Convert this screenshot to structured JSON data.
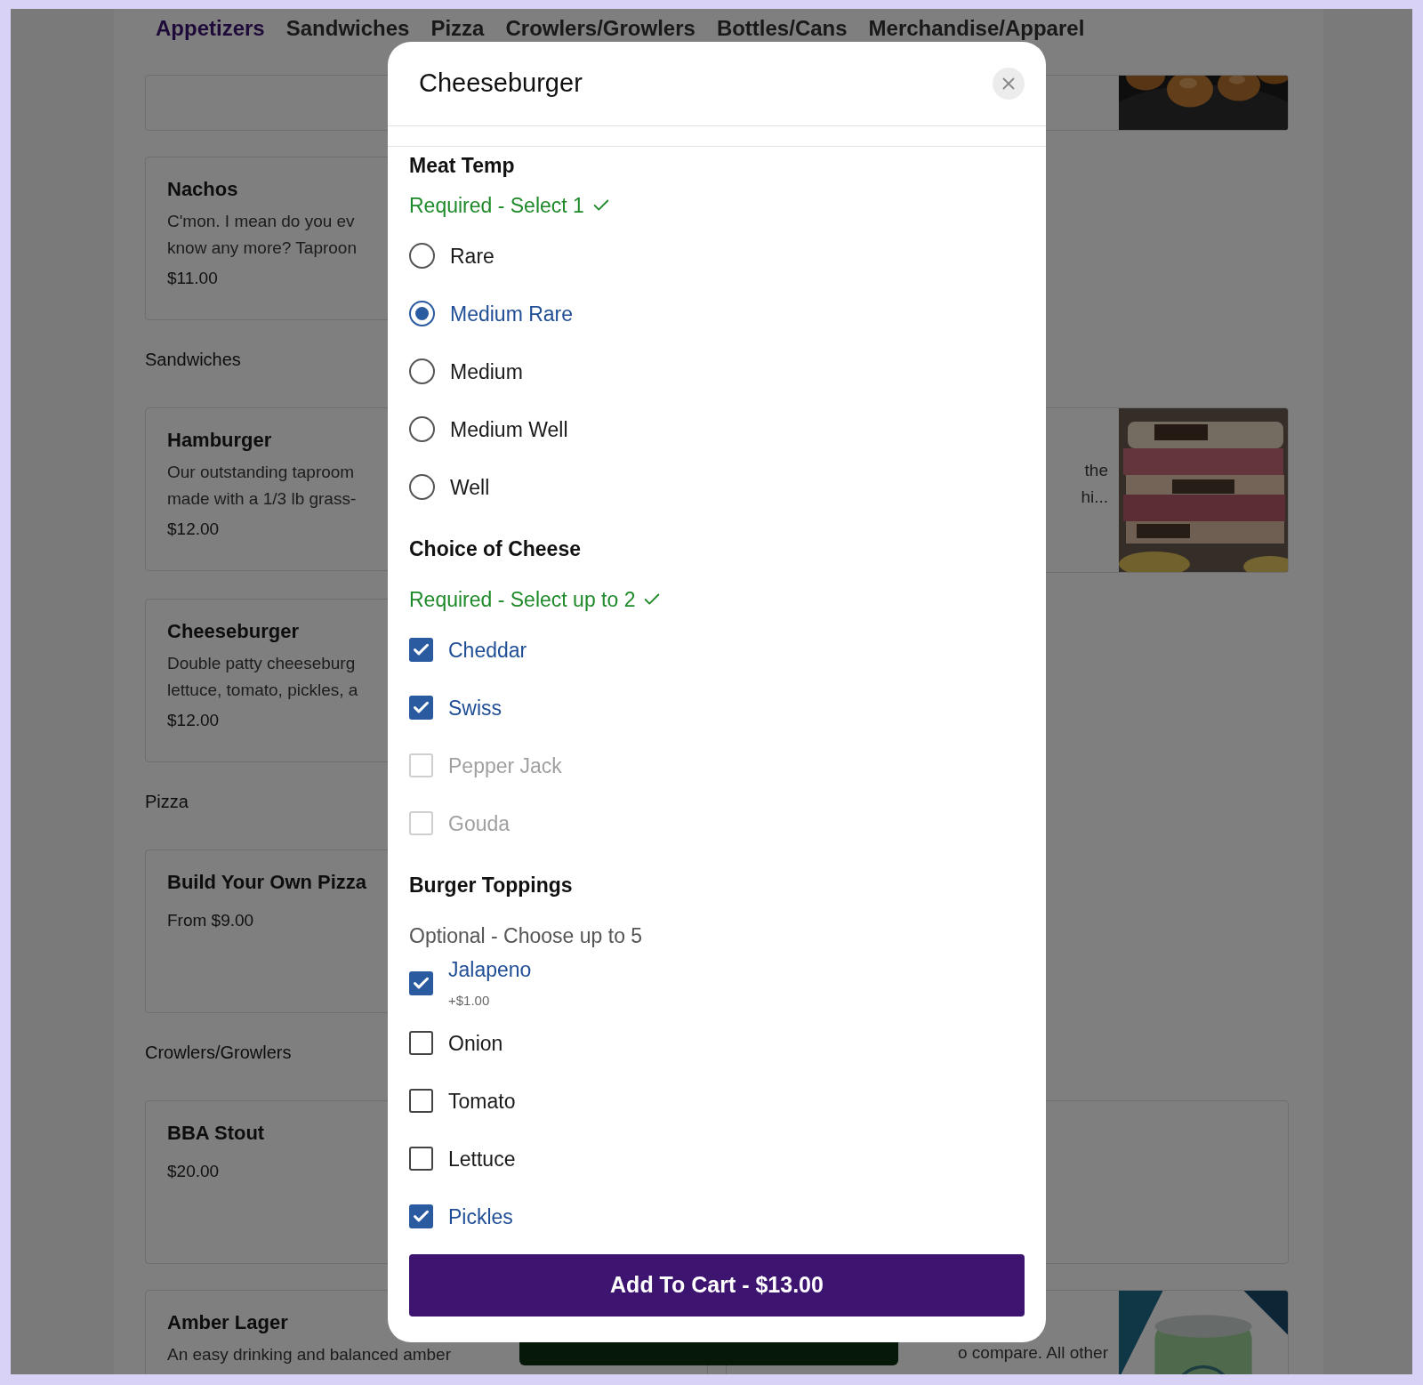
{
  "nav_tabs": [
    {
      "label": "Appetizers",
      "selected": true
    },
    {
      "label": "Sandwiches",
      "selected": false
    },
    {
      "label": "Pizza",
      "selected": false
    },
    {
      "label": "Crowlers/Growlers",
      "selected": false
    },
    {
      "label": "Bottles/Cans",
      "selected": false
    },
    {
      "label": "Merchandise/Apparel",
      "selected": false
    }
  ],
  "sections": [
    {
      "rows": [
        {
          "left": {
            "kind": "empty"
          }
        },
        {
          "left": {
            "kind": "item",
            "name": "Nachos",
            "lines": [
              "C'mon. I mean do you ev",
              "know any more? Taproon"
            ],
            "price": "$11.00"
          }
        }
      ]
    },
    {
      "heading": "Sandwiches",
      "rows": [
        {
          "left": {
            "kind": "item",
            "name": "Hamburger",
            "lines": [
              "Our outstanding taproom",
              "made with a 1/3 lb grass-"
            ],
            "price": "$12.00"
          },
          "right": {
            "kind": "picture",
            "lines": [
              "the",
              "hi..."
            ]
          }
        },
        {
          "left": {
            "kind": "item",
            "name": "Cheeseburger",
            "lines": [
              "Double patty cheeseburg",
              "lettuce, tomato, pickles, a"
            ],
            "price": "$12.00"
          }
        }
      ]
    },
    {
      "heading": "Pizza",
      "rows": [
        {
          "left": {
            "kind": "item",
            "name": "Build Your Own Pizza",
            "price": "From $9.00"
          }
        }
      ]
    },
    {
      "heading": "Crowlers/Growlers",
      "rows": [
        {
          "left": {
            "kind": "item",
            "name": "BBA Stout",
            "price": "$20.00"
          },
          "right": {
            "kind": "empty"
          }
        },
        {
          "left": {
            "kind": "item",
            "name": "Amber Lager",
            "lines": [
              "An easy drinking and balanced amber"
            ]
          },
          "right": {
            "kind": "picture",
            "lines": [
              "o compare. All other"
            ]
          }
        }
      ]
    }
  ],
  "modal": {
    "title": "Cheeseburger",
    "groups": [
      {
        "title": "Meat Temp",
        "requirement": {
          "kind": "required",
          "text": "Required - Select 1"
        },
        "kind": "radio",
        "options": [
          {
            "label": "Rare",
            "selected": false
          },
          {
            "label": "Medium Rare",
            "selected": true
          },
          {
            "label": "Medium",
            "selected": false
          },
          {
            "label": "Medium Well",
            "selected": false
          },
          {
            "label": "Well",
            "selected": false
          }
        ]
      },
      {
        "title": "Choice of Cheese",
        "requirement": {
          "kind": "required",
          "text": "Required - Select up to 2"
        },
        "kind": "checkbox",
        "options": [
          {
            "label": "Cheddar",
            "checked": true,
            "disabled": false
          },
          {
            "label": "Swiss",
            "checked": true,
            "disabled": false
          },
          {
            "label": "Pepper Jack",
            "checked": false,
            "disabled": true
          },
          {
            "label": "Gouda",
            "checked": false,
            "disabled": true
          }
        ]
      },
      {
        "title": "Burger Toppings",
        "requirement": {
          "kind": "optional",
          "text": "Optional - Choose up to 5"
        },
        "kind": "checkbox",
        "options": [
          {
            "label": "Jalapeno",
            "checked": true,
            "disabled": false,
            "price": "+$1.00"
          },
          {
            "label": "Onion",
            "checked": false,
            "disabled": false
          },
          {
            "label": "Tomato",
            "checked": false,
            "disabled": false
          },
          {
            "label": "Lettuce",
            "checked": false,
            "disabled": false
          },
          {
            "label": "Pickles",
            "checked": true,
            "disabled": false
          }
        ]
      }
    ],
    "add_button": "Add To Cart - $13.00"
  }
}
